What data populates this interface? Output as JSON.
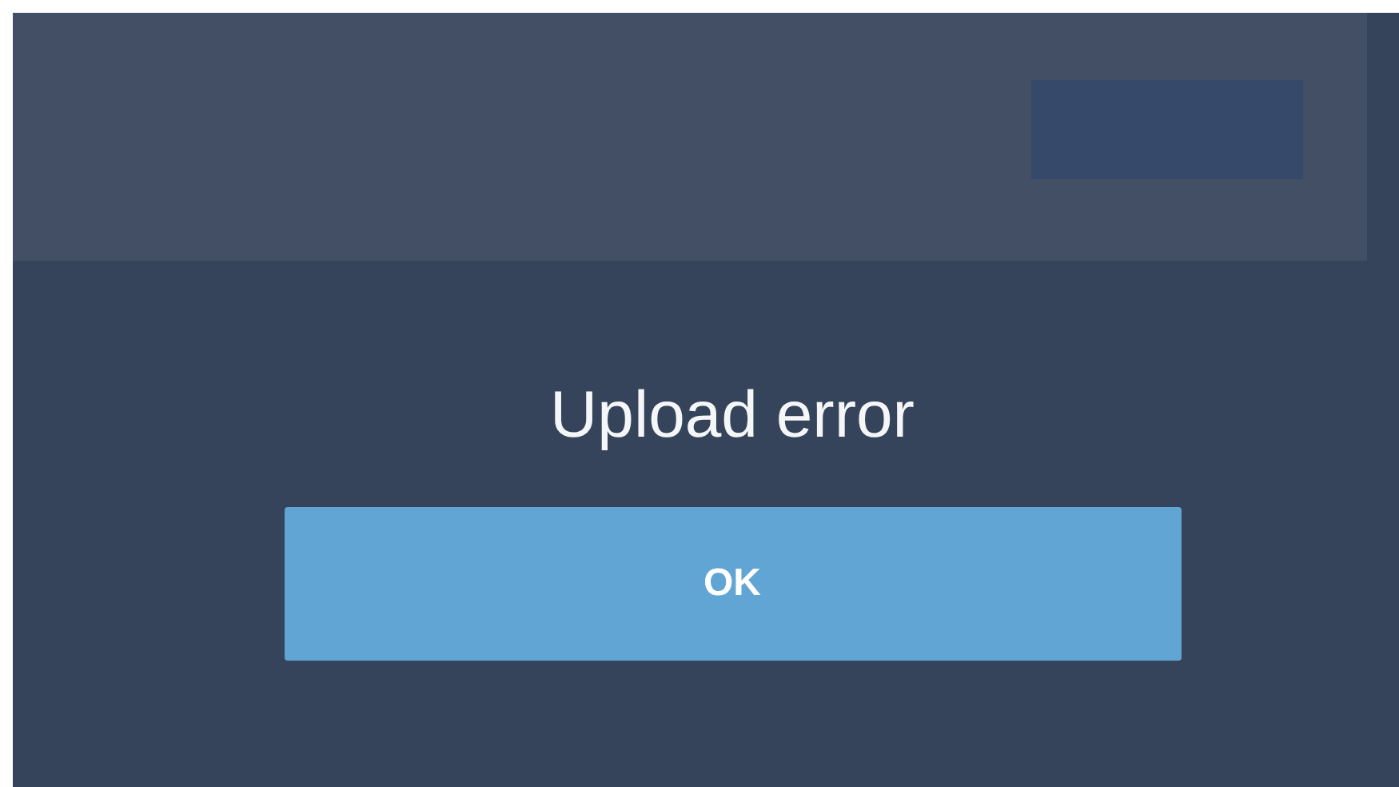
{
  "dialog": {
    "message": "Upload error",
    "buttons": [
      "OK"
    ]
  }
}
